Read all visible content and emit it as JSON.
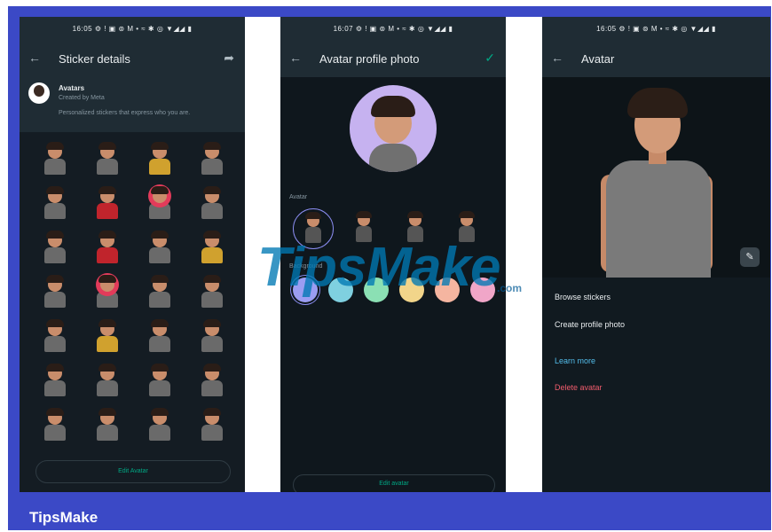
{
  "colors": {
    "frame": "#3b49c6",
    "panel_bg": "#141c23",
    "header_bg": "#1f2c34",
    "accent_green": "#00a884",
    "link_blue": "#53bdeb",
    "danger_red": "#f15c6d"
  },
  "screen1": {
    "status": "16:05 ⚙ ! ▣ ⊚ M • ≈ ✱ ◎ ▼◢◢ ▮",
    "title": "Sticker details",
    "back_icon": "←",
    "share_icon": "➦",
    "pack_name": "Avatars",
    "pack_by": "Created by Meta",
    "pack_desc": "Personalized stickers that express who you are.",
    "button": "Edit Avatar",
    "sticker_count": 28
  },
  "screen2": {
    "status": "16:07 ⚙ ! ▣ ⊚ M • ≈ ✱ ◎ ▼◢◢ ▮",
    "title": "Avatar profile photo",
    "back_icon": "←",
    "confirm_icon": "✓",
    "section_avatar": "Avatar",
    "section_background": "Background",
    "button": "Edit avatar",
    "bg_colors": [
      "#9b9df2",
      "#7fd0e0",
      "#8be0b4",
      "#f2d58a",
      "#f5b5a0",
      "#f0a6c8"
    ]
  },
  "screen3": {
    "status": "16:05 ⚙ ! ▣ ⊚ M • ≈ ✱ ◎ ▼◢◢ ▮",
    "title": "Avatar",
    "back_icon": "←",
    "edit_icon": "✎",
    "menu": {
      "browse": "Browse stickers",
      "create": "Create profile photo",
      "learn": "Learn more",
      "delete": "Delete avatar"
    }
  },
  "watermark": "TipsMake",
  "watermark_suffix": ".com",
  "brand": "TipsMake"
}
